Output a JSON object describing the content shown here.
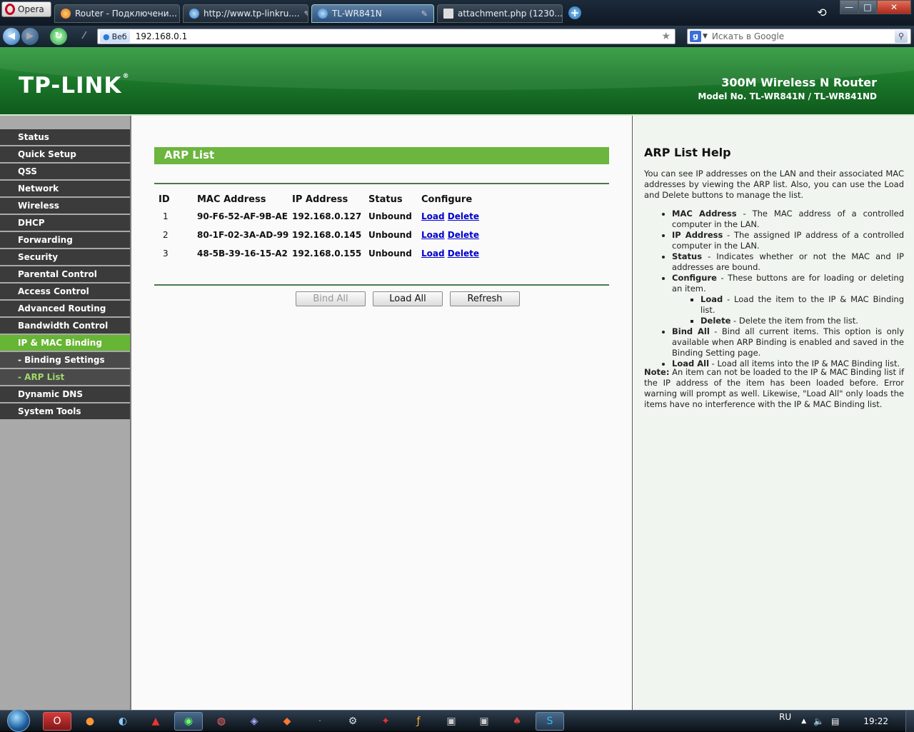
{
  "browser": {
    "opera_label": "Opera",
    "tabs": [
      {
        "title": "Router - Подключени...",
        "color": "#e86a1a"
      },
      {
        "title": "http://www.tp-linkru....",
        "color": "#2a7bd4"
      },
      {
        "title": "TL-WR841N",
        "color": "#2a7bd4"
      },
      {
        "title": "attachment.php (1230...",
        "color": "#cccccc"
      }
    ],
    "address": {
      "web_badge": "Веб",
      "url": "192.168.0.1"
    },
    "search": {
      "placeholder": "Искать в Google"
    },
    "window_controls": {
      "minimize": "—",
      "maximize": "□",
      "close": "✕"
    }
  },
  "router": {
    "brand": "TP-LINK",
    "brand_mark": "®",
    "product": "300M Wireless N Router",
    "model": "Model No. TL-WR841N / TL-WR841ND"
  },
  "sidebar": {
    "items": [
      {
        "label": "Status",
        "state": "normal"
      },
      {
        "label": "Quick Setup",
        "state": "normal"
      },
      {
        "label": "QSS",
        "state": "normal"
      },
      {
        "label": "Network",
        "state": "normal"
      },
      {
        "label": "Wireless",
        "state": "normal"
      },
      {
        "label": "DHCP",
        "state": "normal"
      },
      {
        "label": "Forwarding",
        "state": "normal"
      },
      {
        "label": "Security",
        "state": "normal"
      },
      {
        "label": "Parental Control",
        "state": "normal"
      },
      {
        "label": "Access Control",
        "state": "normal"
      },
      {
        "label": "Advanced Routing",
        "state": "normal"
      },
      {
        "label": "Bandwidth Control",
        "state": "normal"
      },
      {
        "label": "IP & MAC Binding",
        "state": "active"
      },
      {
        "label": "- Binding Settings",
        "state": "sub"
      },
      {
        "label": "- ARP List",
        "state": "subactive"
      },
      {
        "label": "Dynamic DNS",
        "state": "normal"
      },
      {
        "label": "System Tools",
        "state": "normal"
      }
    ]
  },
  "main": {
    "title": "ARP List",
    "columns": [
      "ID",
      "MAC Address",
      "IP Address",
      "Status",
      "Configure"
    ],
    "rows": [
      {
        "id": "1",
        "mac": "90-F6-52-AF-9B-AE",
        "ip": "192.168.0.127",
        "status": "Unbound",
        "load": "Load",
        "delete": "Delete"
      },
      {
        "id": "2",
        "mac": "80-1F-02-3A-AD-99",
        "ip": "192.168.0.145",
        "status": "Unbound",
        "load": "Load",
        "delete": "Delete"
      },
      {
        "id": "3",
        "mac": "48-5B-39-16-15-A2",
        "ip": "192.168.0.155",
        "status": "Unbound",
        "load": "Load",
        "delete": "Delete"
      }
    ],
    "buttons": {
      "bind_all": "Bind All",
      "load_all": "Load All",
      "refresh": "Refresh"
    }
  },
  "help": {
    "title": "ARP List Help",
    "intro": "You can see IP addresses on the LAN and their associated MAC addresses by viewing the ARP list. Also, you can use the Load and Delete buttons to manage the list.",
    "items": [
      {
        "term": "MAC Address",
        "text": " - The MAC address of a controlled computer in the LAN."
      },
      {
        "term": "IP Address",
        "text": " - The assigned IP address of a controlled computer in the LAN."
      },
      {
        "term": "Status",
        "text": " - Indicates whether or not the MAC and IP addresses are bound."
      },
      {
        "term": "Configure",
        "text": " - These buttons are for loading or deleting an item."
      },
      {
        "term": "Bind All",
        "text": " - Bind all current items. This option is only available when ARP Binding is enabled and saved in the Binding Setting page."
      },
      {
        "term": "Load All",
        "text": " - Load all items into the IP & MAC Binding list."
      }
    ],
    "subitems": [
      {
        "term": "Load",
        "text": " - Load the item to the IP & MAC Binding list."
      },
      {
        "term": "Delete",
        "text": " - Delete the item from the list."
      }
    ],
    "note_label": "Note:",
    "note": " An item can not be loaded to the IP & MAC Binding list if the IP address of the item has been loaded before. Error warning will prompt as well. Likewise, \"Load All\" only loads the items have no interference with the IP & MAC Binding list."
  },
  "taskbar": {
    "lang": "RU",
    "time": "19:22"
  }
}
